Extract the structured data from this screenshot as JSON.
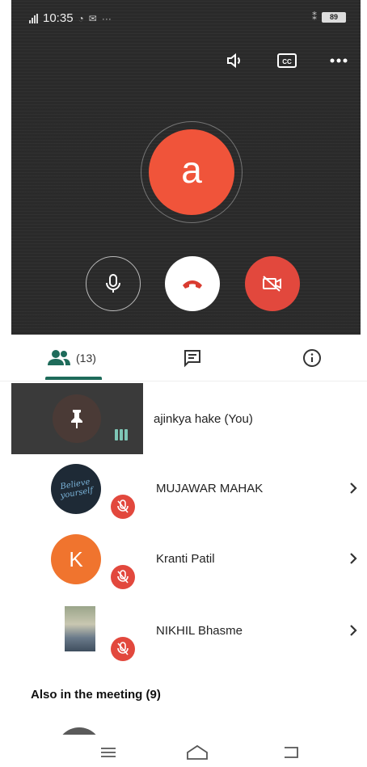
{
  "status_bar": {
    "time": "10:35",
    "battery": "89"
  },
  "call": {
    "avatar_letter": "a",
    "icons": {
      "speaker": "speaker-icon",
      "captions": "closed-captions-icon",
      "more": "more-horizontal-icon",
      "mic": "microphone-icon",
      "end_call": "end-call-icon",
      "camera_off": "camera-off-icon"
    }
  },
  "tabs": {
    "people_count": "(13)",
    "items": [
      "people-tab",
      "chat-tab",
      "info-tab"
    ],
    "active": "people"
  },
  "participants": {
    "self": {
      "name": "ajinkya hake (You)"
    },
    "others": [
      {
        "name": "MUJAWAR MAHAK",
        "avatar_text": "Believe yourself",
        "muted": true
      },
      {
        "name": "Kranti Patil",
        "avatar_letter": "K",
        "muted": true
      },
      {
        "name": "NIKHIL Bhasme",
        "muted": true
      }
    ],
    "also_heading": "Also in the meeting (9)"
  },
  "colors": {
    "accent": "#1e6b5a",
    "avatar_a": "#f0543a",
    "avatar_k": "#f0742e",
    "mute_red": "#e2483d",
    "call_bg": "#2a2a2a"
  }
}
